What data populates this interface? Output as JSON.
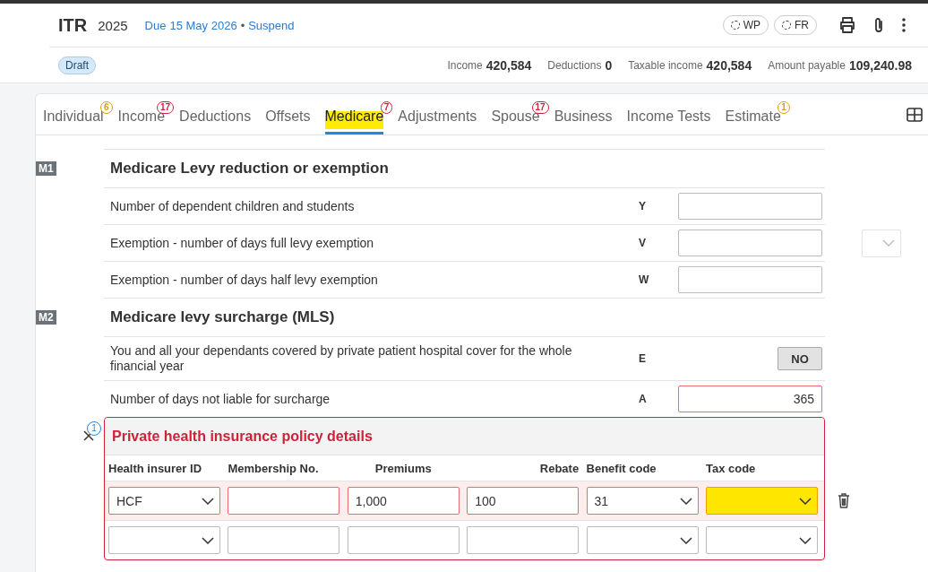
{
  "header": {
    "title": "ITR",
    "year": "2025",
    "due_label": "Due",
    "due_date": "15 May 2026",
    "separator": "•",
    "action": "Suspend",
    "chips": [
      "WP",
      "FR"
    ]
  },
  "status": "Draft",
  "summary": [
    {
      "label": "Income",
      "value": "420,584"
    },
    {
      "label": "Deductions",
      "value": "0"
    },
    {
      "label": "Taxable income",
      "value": "420,584"
    },
    {
      "label": "Amount payable",
      "value": "109,240.98"
    }
  ],
  "tabs": [
    {
      "label": "Individual",
      "selected": false,
      "highlighted": false,
      "badge": "6",
      "color": "#d4a017"
    },
    {
      "label": "Income",
      "selected": false,
      "highlighted": false,
      "badge": "17",
      "color": "#d0213a"
    },
    {
      "label": "Deductions",
      "selected": false,
      "highlighted": false
    },
    {
      "label": "Offsets",
      "selected": false,
      "highlighted": false
    },
    {
      "label": "Medicare",
      "selected": true,
      "highlighted": true,
      "badge": "7",
      "color": "#d0213a"
    },
    {
      "label": "Adjustments",
      "selected": false,
      "highlighted": false
    },
    {
      "label": "Spouse",
      "selected": false,
      "highlighted": false,
      "badge": "17",
      "color": "#d0213a"
    },
    {
      "label": "Business",
      "selected": false,
      "highlighted": false
    },
    {
      "label": "Income Tests",
      "selected": false,
      "highlighted": false
    },
    {
      "label": "Estimate",
      "selected": false,
      "highlighted": false,
      "badge": "1",
      "color": "#d4a017"
    }
  ],
  "sections": [
    {
      "code": "M1",
      "title": "Medicare Levy reduction or exemption",
      "rows": [
        {
          "kind": "input",
          "label": "Number of dependent children and students",
          "letter": "Y",
          "error": false
        },
        {
          "kind": "input",
          "label": "Exemption - number of days full levy exemption",
          "letter": "V",
          "error": false,
          "side_dropdown": true
        },
        {
          "kind": "input",
          "label": "Exemption - number of days half levy exemption",
          "letter": "W",
          "error": false
        }
      ]
    },
    {
      "code": "M2",
      "title": "Medicare levy surcharge (MLS)",
      "rows": [
        {
          "kind": "toggle",
          "label": "You and all your dependants covered by private patient hospital cover for the whole financial year",
          "letter": "E",
          "value": "NO"
        },
        {
          "kind": "input",
          "label": "Number of days not liable for surcharge",
          "letter": "A",
          "value": "365",
          "error": true
        }
      ]
    }
  ],
  "policy": {
    "badge": "1",
    "title": "Private health insurance policy details",
    "columns": [
      "Health insurer ID",
      "Membership No.",
      "Premiums",
      "Rebate",
      "Benefit code",
      "Tax code"
    ],
    "rows": [
      {
        "deletable": true,
        "cells": [
          {
            "kind": "select",
            "value": "HCF",
            "error": true,
            "highlighted": false
          },
          {
            "kind": "input",
            "error": true,
            "highlighted": false
          },
          {
            "kind": "input",
            "value": "1,000",
            "error": true,
            "highlighted": false
          },
          {
            "kind": "input",
            "value": "100",
            "error": true,
            "highlighted": false
          },
          {
            "kind": "select",
            "value": "31",
            "error": true,
            "highlighted": false
          },
          {
            "kind": "select",
            "error": true,
            "highlighted": true
          }
        ]
      },
      {
        "cells": [
          {
            "kind": "select",
            "error": false,
            "highlighted": false
          },
          {
            "kind": "input",
            "error": false,
            "highlighted": false
          },
          {
            "kind": "input",
            "error": false,
            "highlighted": false
          },
          {
            "kind": "input",
            "error": false,
            "highlighted": false
          },
          {
            "kind": "select",
            "error": false,
            "highlighted": false
          },
          {
            "kind": "select",
            "error": false,
            "highlighted": false
          }
        ]
      }
    ]
  }
}
